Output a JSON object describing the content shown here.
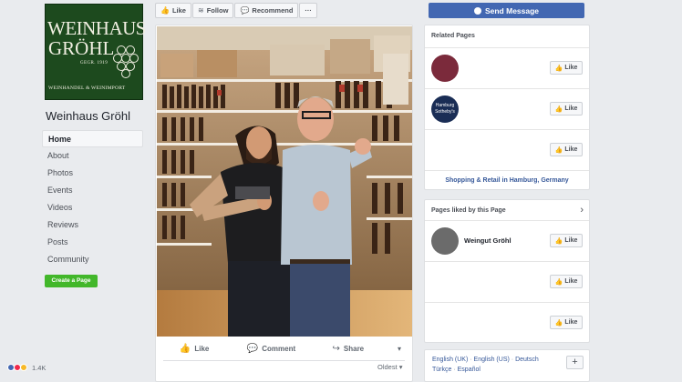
{
  "logo": {
    "line1": "WEINHAUS",
    "line2": "GRÖHL",
    "since": "GEGR. 1919",
    "tagline": "WEINHANDEL & WEINIMPORT"
  },
  "page_name": "Weinhaus Gröhl",
  "nav": {
    "items": [
      {
        "label": "Home",
        "active": true
      },
      {
        "label": "About"
      },
      {
        "label": "Photos"
      },
      {
        "label": "Events"
      },
      {
        "label": "Videos"
      },
      {
        "label": "Reviews"
      },
      {
        "label": "Posts"
      },
      {
        "label": "Community"
      }
    ],
    "create_page": "Create a Page"
  },
  "action_bar": {
    "like": "Like",
    "follow": "Follow",
    "recommend": "Recommend",
    "more": "···",
    "send_message": "Send Message"
  },
  "post": {
    "like": "Like",
    "comment": "Comment",
    "share": "Share",
    "reaction_count": "1.4K",
    "sort": "Oldest"
  },
  "related": {
    "title": "Related Pages",
    "like": "Like",
    "hamburg_logo_1": "Hamburg",
    "hamburg_logo_2": "Sotheby's",
    "category_link": "Shopping & Retail in Hamburg, Germany"
  },
  "liked": {
    "title": "Pages liked by this Page",
    "first_name": "Weingut Gröhl",
    "like": "Like"
  },
  "languages": {
    "line1": [
      "English (UK)",
      "English (US)",
      "Deutsch"
    ],
    "line2": [
      "Türkçe",
      "Español"
    ],
    "plus": "+"
  },
  "colors": {
    "facebook_blue": "#4267b2",
    "link_blue": "#365899",
    "create_green": "#42b72a",
    "logo_green": "#1d4a1e"
  }
}
